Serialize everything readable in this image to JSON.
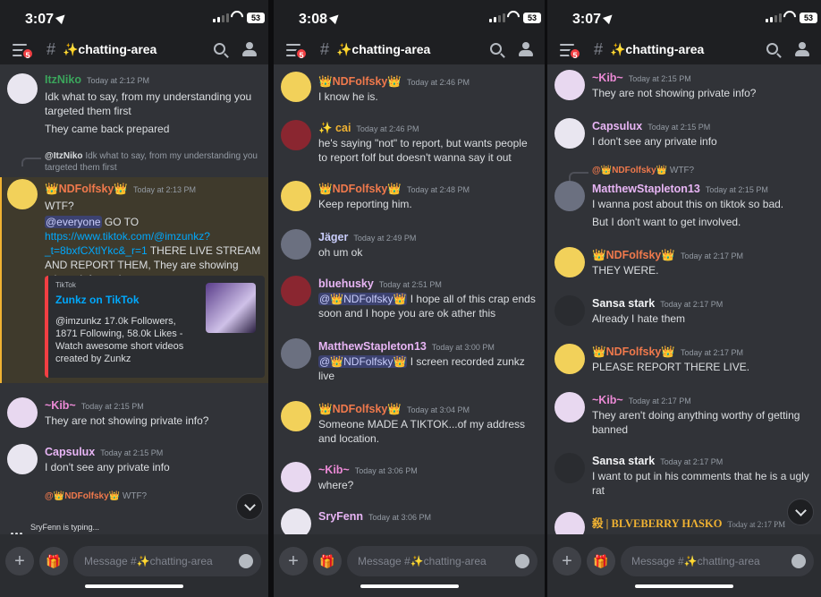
{
  "channel": {
    "name": "✨chatting-area",
    "hash": "#",
    "badge": "5"
  },
  "panels": [
    {
      "time": "3:07",
      "battery": "53"
    },
    {
      "time": "3:08",
      "battery": "53"
    },
    {
      "time": "3:07",
      "battery": "53"
    }
  ],
  "composer": {
    "placeholder": "Message #✨chatting-area",
    "plus": "+"
  },
  "typing": "SryFenn is typing...",
  "colors": {
    "bg": "#313338",
    "bar": "#1e1f22",
    "mention_hl": "#3f3a2c",
    "link": "#00a8fc",
    "green": "#3ba55c",
    "orange": "#f0794c",
    "pink": "#ec8ad6",
    "yellow": "#f0b232"
  },
  "p1": {
    "m1": {
      "name": "ItzNiko",
      "ts": "Today at 2:12 PM",
      "l1": "Idk what to say, from my understanding you targeted them first",
      "l2": "They came back prepared"
    },
    "r1": {
      "user": "@ItzNiko",
      "text": "Idk what to say, from my understanding you targeted them first"
    },
    "m2": {
      "name": "👑NDFolfsky👑",
      "ts": "Today at 2:13 PM",
      "l1": "WTF?",
      "mention": "@everyone",
      "t1": " GO TO ",
      "link": "https://www.tiktok.com/@imzunkz?_t=8bxfCXtlYkc&_r=1",
      "t2": " THERE LIVE STREAM AND REPORT THEM, They are showing private information"
    },
    "embed": {
      "provider": "TikTok",
      "title": "Zunkz on TikTok",
      "desc": "@imzunkz 17.0k Followers, 1871 Following, 58.0k Likes - Watch awesome short videos created by Zunkz"
    },
    "m3": {
      "name": "~Kib~",
      "ts": "Today at 2:15 PM",
      "text": "They are not showing private info?"
    },
    "m4": {
      "name": "Capsulux",
      "ts": "Today at 2:15 PM",
      "text": "I don't see any private info"
    },
    "r2": {
      "user": "@👑NDFolfsky👑",
      "text": "WTF?"
    }
  },
  "p2": {
    "m1": {
      "name": "👑NDFolfsky👑",
      "ts": "Today at 2:46 PM",
      "text": "I know he is."
    },
    "m2": {
      "name": "✨ cai",
      "ts": "Today at 2:46 PM",
      "text": "he's saying \"not\" to report, but wants people to report folf but doesn't wanna say it out"
    },
    "m3": {
      "name": "👑NDFolfsky👑",
      "ts": "Today at 2:48 PM",
      "text": "Keep reporting him."
    },
    "m4": {
      "name": "Jäger",
      "ts": "Today at 2:49 PM",
      "text": "oh um ok"
    },
    "m5": {
      "name": "bluehusky",
      "ts": "Today at 2:51 PM",
      "mention": "@👑NDFolfsky👑",
      "text": " I hope all of this crap ends soon and I hope you are ok ather this"
    },
    "m6": {
      "name": "MatthewStapleton13",
      "ts": "Today at 3:00 PM",
      "mention": "@👑NDFolfsky👑",
      "text": " I screen recorded zunkz live"
    },
    "m7": {
      "name": "👑NDFolfsky👑",
      "ts": "Today at 3:04 PM",
      "text": "Someone MADE A TIKTOK...of my address and location."
    },
    "m8": {
      "name": "~Kib~",
      "ts": "Today at 3:06 PM",
      "text": "where?"
    },
    "m9": {
      "name": "SryFenn",
      "ts": "Today at 3:06 PM"
    }
  },
  "p3": {
    "m1": {
      "name": "~Kib~",
      "ts": "Today at 2:15 PM",
      "text": "They are not showing private info?"
    },
    "m2": {
      "name": "Capsulux",
      "ts": "Today at 2:15 PM",
      "text": "I don't see any private info"
    },
    "r1": {
      "user": "@👑NDFolfsky👑",
      "text": "WTF?"
    },
    "m3": {
      "name": "MatthewStapleton13",
      "ts": "Today at 2:15 PM",
      "l1": "I wanna post about this on tiktok so bad.",
      "l2": "But I don't want to get involved."
    },
    "m4": {
      "name": "👑NDFolfsky👑",
      "ts": "Today at 2:17 PM",
      "text": "THEY WERE."
    },
    "m5": {
      "name": "Sansa stark",
      "ts": "Today at 2:17 PM",
      "text": "Already I hate them"
    },
    "m6": {
      "name": "👑NDFolfsky👑",
      "ts": "Today at 2:17 PM",
      "text": "PLEASE REPORT THERE LIVE."
    },
    "m7": {
      "name": "~Kib~",
      "ts": "Today at 2:17 PM",
      "text": "They aren't doing anything worthy of getting banned"
    },
    "m8": {
      "name": "Sansa stark",
      "ts": "Today at 2:17 PM",
      "text": "I want to put in his comments that he is a ugly rat"
    },
    "m9": {
      "name": "殺 | BLVEBERRY HΛSKO",
      "ts": "Today at 2:17 PM"
    }
  }
}
